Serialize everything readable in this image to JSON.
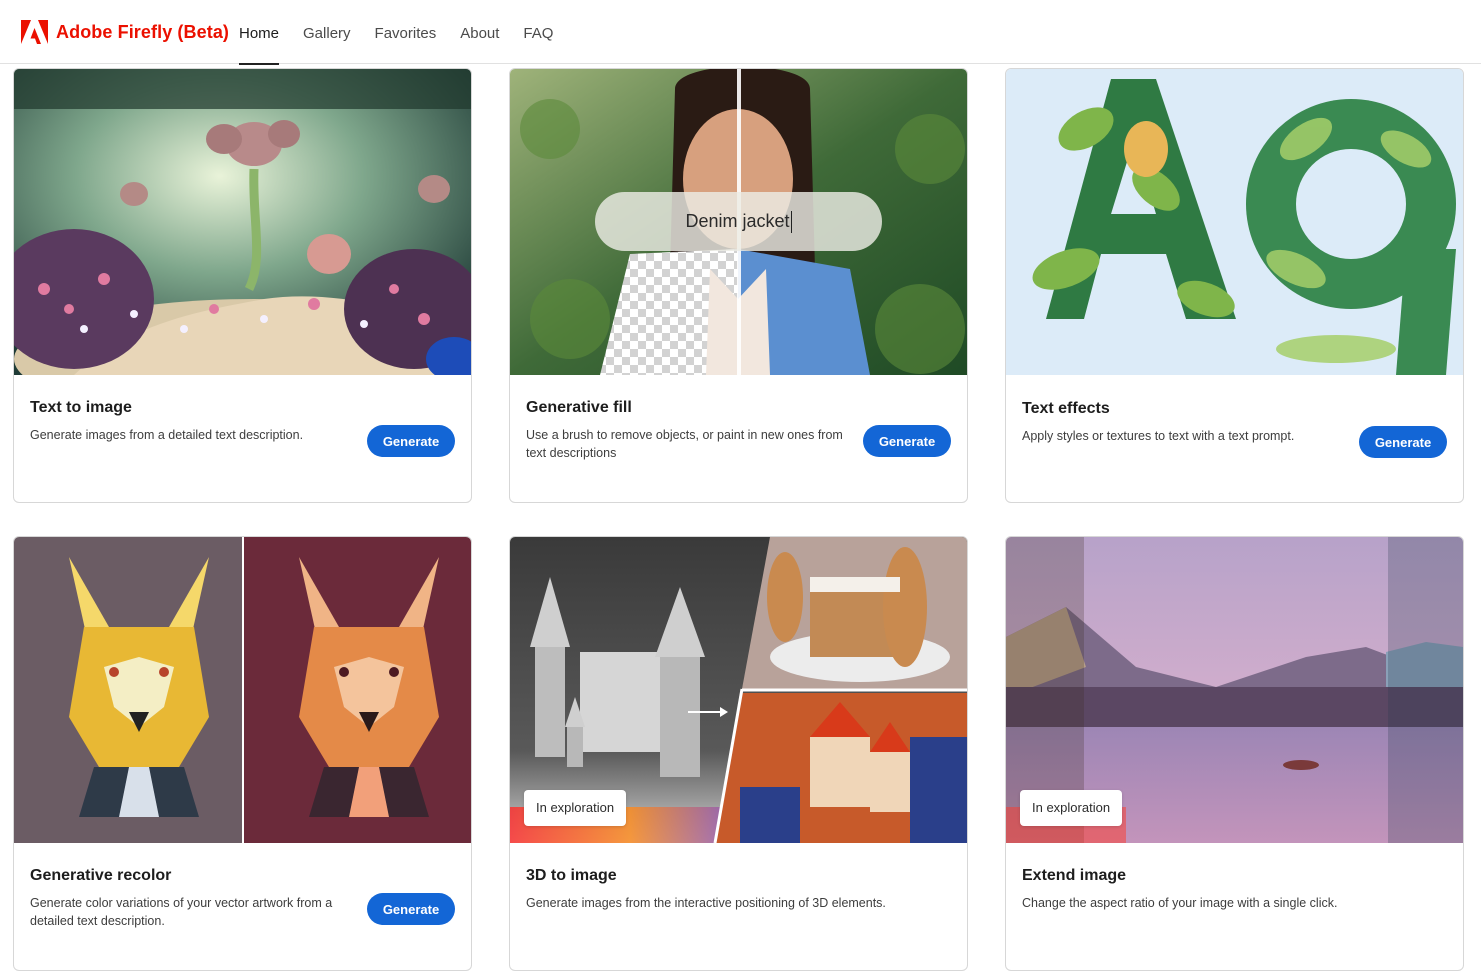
{
  "app": {
    "title": "Adobe Firefly (Beta)",
    "brand_color": "#eb1000"
  },
  "nav": {
    "items": [
      {
        "label": "Home",
        "active": true
      },
      {
        "label": "Gallery",
        "active": false
      },
      {
        "label": "Favorites",
        "active": false
      },
      {
        "label": "About",
        "active": false
      },
      {
        "label": "FAQ",
        "active": false
      }
    ]
  },
  "cards": [
    {
      "title": "Text to image",
      "description": "Generate images from a detailed text description.",
      "button": "Generate",
      "image_icon": "fantasy-garden-image"
    },
    {
      "title": "Generative fill",
      "description": "Use a brush to remove objects, or paint in new ones from text descriptions",
      "button": "Generate",
      "prompt_text": "Denim jacket",
      "image_icon": "portrait-fill-image"
    },
    {
      "title": "Text effects",
      "description": "Apply styles or textures to text with a text prompt.",
      "button": "Generate",
      "image_icon": "leaf-letters-image"
    },
    {
      "title": "Generative recolor",
      "description": "Generate color variations of your vector artwork from a detailed text description.",
      "button": "Generate",
      "image_icon": "recolored-dog-image"
    },
    {
      "title": "3D to image",
      "description": "Generate images from the interactive positioning of 3D elements.",
      "badge": "In exploration",
      "image_icon": "castle-3d-image"
    },
    {
      "title": "Extend image",
      "description": "Change the aspect ratio of your image with a single click.",
      "badge": "In exploration",
      "image_icon": "lake-landscape-image"
    }
  ],
  "colors": {
    "primary_button": "#1366d6"
  }
}
